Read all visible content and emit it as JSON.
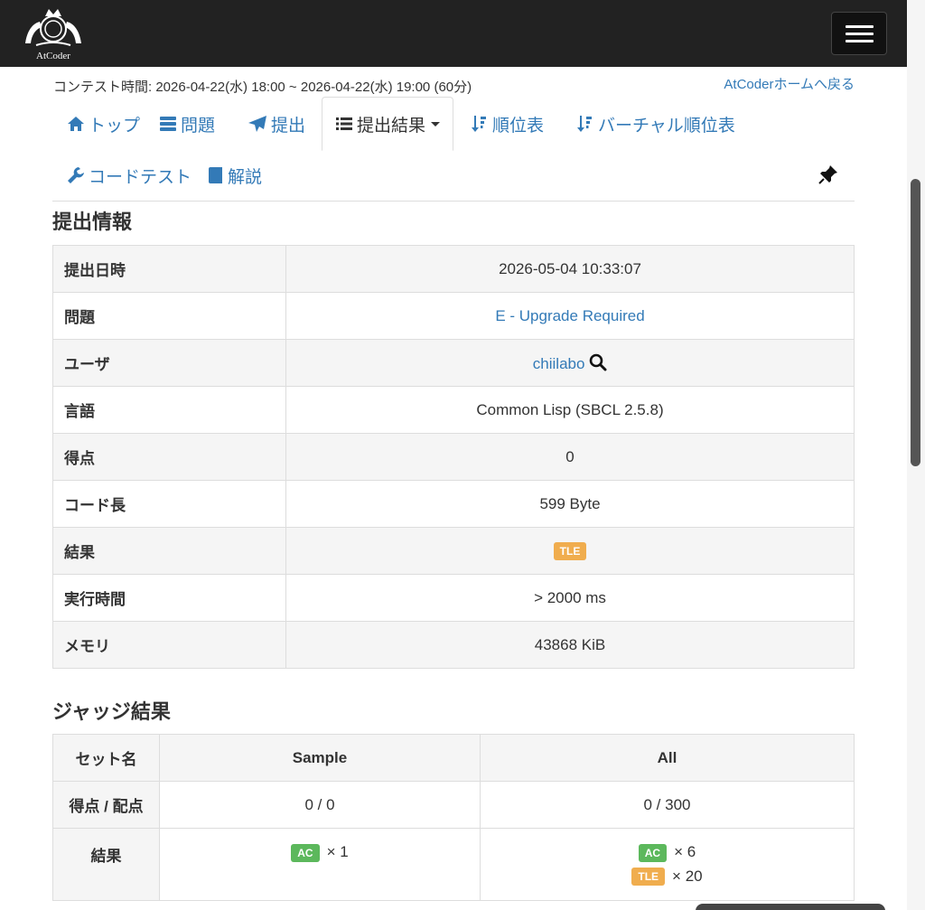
{
  "header": {
    "logo_text": "AtCoder",
    "menu_icon": "hamburger-icon"
  },
  "contest_time": "コンテスト時間: 2026-04-22(水) 18:00 ~ 2026-04-22(水) 19:00 (60分)",
  "home_link": "AtCoderホームへ戻る",
  "tabs": {
    "top": "トップ",
    "tasks": "問題",
    "submit": "提出",
    "results": "提出結果",
    "standings": "順位表",
    "virtual": "バーチャル順位表",
    "custom_test": "コードテスト",
    "editorial": "解説"
  },
  "submission": {
    "heading": "提出情報",
    "rows": [
      {
        "key": "提出日時",
        "value": "2026-05-04 10:33:07"
      },
      {
        "key": "問題",
        "value": "E - Upgrade Required"
      },
      {
        "key": "ユーザ",
        "value": "chiilabo"
      },
      {
        "key": "言語",
        "value": "Common Lisp (SBCL 2.5.8)"
      },
      {
        "key": "得点",
        "value": "0"
      },
      {
        "key": "コード長",
        "value": "599 Byte"
      },
      {
        "key": "結果",
        "value": "TLE"
      },
      {
        "key": "実行時間",
        "value": "> 2000 ms"
      },
      {
        "key": "メモリ",
        "value": "43868 KiB"
      }
    ]
  },
  "judge": {
    "heading": "ジャッジ結果",
    "set_name": "セット名",
    "col_sample": "Sample",
    "col_all": "All",
    "score_label": "得点 / 配点",
    "score_sample": "0 / 0",
    "score_all": "0 / 300",
    "result_label": "結果",
    "sample_results": [
      {
        "status": "AC",
        "count": "× 1"
      }
    ],
    "all_results": [
      {
        "status": "AC",
        "count": "× 6"
      },
      {
        "status": "TLE",
        "count": "× 20"
      }
    ]
  },
  "colors": {
    "navbar": "#222222",
    "link": "#337ab7",
    "tle": "#f0ad4e",
    "ac": "#5cb85c"
  }
}
